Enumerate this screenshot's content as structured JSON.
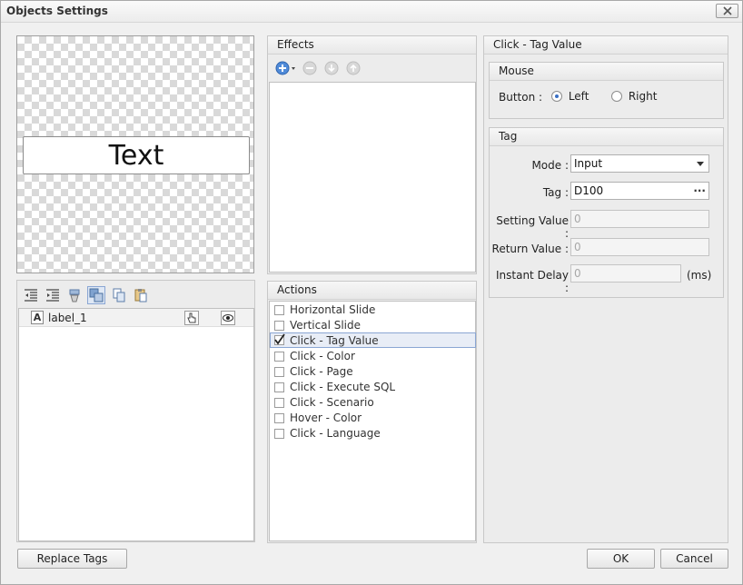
{
  "window": {
    "title": "Objects Settings"
  },
  "preview": {
    "widget_text": "Text"
  },
  "layers": {
    "items": [
      {
        "name": "label_1"
      }
    ]
  },
  "effects": {
    "header": "Effects"
  },
  "actions": {
    "header": "Actions",
    "items": [
      {
        "label": "Horizontal Slide",
        "checked": false
      },
      {
        "label": "Vertical Slide",
        "checked": false
      },
      {
        "label": "Click - Tag Value",
        "checked": true
      },
      {
        "label": "Click - Color",
        "checked": false
      },
      {
        "label": "Click - Page",
        "checked": false
      },
      {
        "label": "Click - Execute SQL",
        "checked": false
      },
      {
        "label": "Click - Scenario",
        "checked": false
      },
      {
        "label": "Hover - Color",
        "checked": false
      },
      {
        "label": "Click - Language",
        "checked": false
      }
    ]
  },
  "settings": {
    "header": "Click - Tag Value",
    "mouse": {
      "header": "Mouse",
      "button_label": "Button :",
      "left_label": "Left",
      "right_label": "Right",
      "selected": "Left"
    },
    "tag": {
      "header": "Tag",
      "mode_label": "Mode :",
      "mode_value": "Input",
      "tag_label": "Tag :",
      "tag_value": "D100",
      "tag_browse": "···",
      "setting_label": "Setting Value :",
      "setting_value": "0",
      "return_label": "Return Value :",
      "return_value": "0",
      "delay_label": "Instant Delay :",
      "delay_value": "0",
      "delay_unit": "(ms)"
    }
  },
  "buttons": {
    "replace_tags": "Replace Tags",
    "ok": "OK",
    "cancel": "Cancel"
  },
  "colors": {
    "accent": "#3a6fc4",
    "selection_border": "#8aa6d3",
    "selection_fill": "#e8edf6"
  }
}
